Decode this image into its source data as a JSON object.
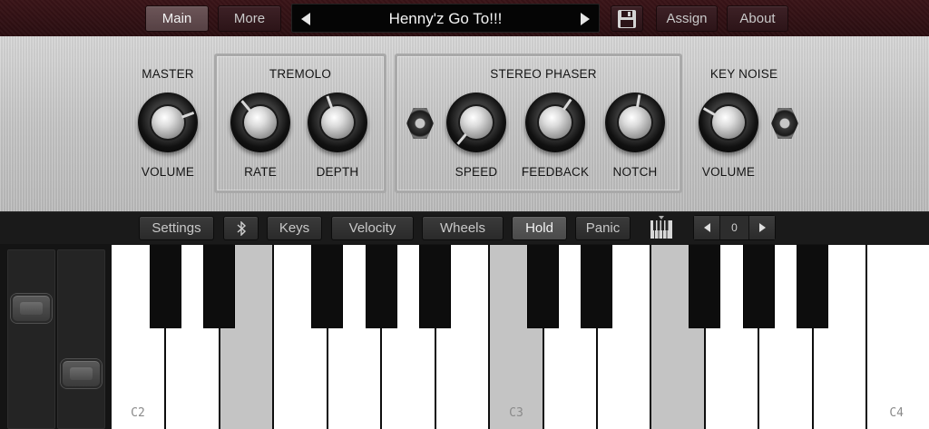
{
  "topbar": {
    "main_label": "Main",
    "more_label": "More",
    "preset_name": "Henny'z Go To!!!",
    "assign_label": "Assign",
    "about_label": "About"
  },
  "panel": {
    "master": {
      "title": "MASTER",
      "volume_label": "VOLUME"
    },
    "tremolo": {
      "title": "TREMOLO",
      "rate_label": "RATE",
      "depth_label": "DEPTH"
    },
    "phaser": {
      "title": "STEREO PHASER",
      "speed_label": "SPEED",
      "feedback_label": "FEEDBACK",
      "notch_label": "NOTCH"
    },
    "keynoise": {
      "title": "KEY NOISE",
      "volume_label": "VOLUME"
    }
  },
  "strip": {
    "settings_label": "Settings",
    "keys_label": "Keys",
    "velocity_label": "Velocity",
    "wheels_label": "Wheels",
    "hold_label": "Hold",
    "panic_label": "Panic",
    "octave_value": "0"
  },
  "keyboard": {
    "labels": {
      "c2": "C2",
      "c3": "C3",
      "c4": "C4"
    }
  },
  "icons": {
    "preset_prev": "triangle-left-icon",
    "preset_next": "triangle-right-icon",
    "save": "floppy-disk-icon",
    "bluetooth": "bluetooth-icon",
    "keyboard": "piano-keys-icon"
  },
  "colors": {
    "topbar_bg": "#2e1014",
    "panel_bg": "#c8c8c8",
    "active_button": "#5d5d5d",
    "held_key": "#c4c4c4"
  }
}
